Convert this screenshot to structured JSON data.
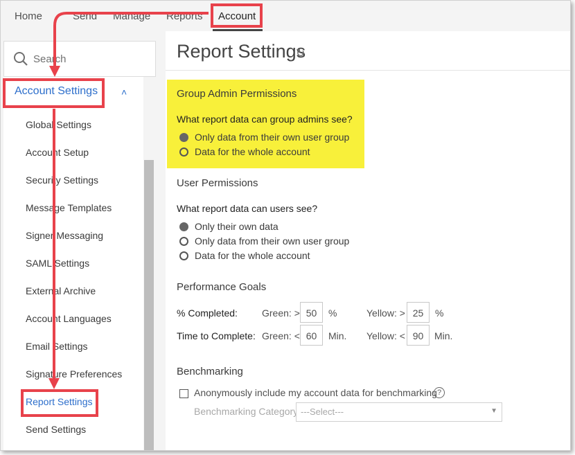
{
  "topnav": {
    "items": [
      "Home",
      "Send",
      "Manage",
      "Reports",
      "Account"
    ]
  },
  "sidebar": {
    "search_placeholder": "Search",
    "section_label": "Account Settings",
    "items": [
      "Global Settings",
      "Account Setup",
      "Security Settings",
      "Message Templates",
      "Signer Messaging",
      "SAML Settings",
      "External Archive",
      "Account Languages",
      "Email Settings",
      "Signature Preferences",
      "Report Settings",
      "Send Settings"
    ]
  },
  "main": {
    "title": "Report Settings",
    "group_admin": {
      "heading": "Group Admin Permissions",
      "question": "What report data can group admins see?",
      "options": [
        "Only data from their own user group",
        "Data for the whole account"
      ],
      "selected_index": 0
    },
    "user_permissions": {
      "heading": "User Permissions",
      "question": "What report data can users see?",
      "options": [
        "Only their own data",
        "Only data from their own user group",
        "Data for the whole account"
      ],
      "selected_index": 0
    },
    "performance": {
      "heading": "Performance Goals",
      "rows": [
        {
          "label": "% Completed:",
          "green_label": "Green: >",
          "green_value": "50",
          "green_unit": "%",
          "yellow_label": "Yellow: >",
          "yellow_value": "25",
          "yellow_unit": "%"
        },
        {
          "label": "Time to Complete:",
          "green_label": "Green: <",
          "green_value": "60",
          "green_unit": "Min.",
          "yellow_label": "Yellow: <",
          "yellow_value": "90",
          "yellow_unit": "Min."
        }
      ]
    },
    "benchmarking": {
      "heading": "Benchmarking",
      "checkbox_label": "Anonymously include my account data for benchmarking",
      "help_glyph": "?",
      "category_label": "Benchmarking Category",
      "select_value": "---Select---"
    }
  },
  "colors": {
    "accent": "#2c6ecb",
    "highlight": "#f8f03a",
    "annotation_red": "#e8424b"
  }
}
